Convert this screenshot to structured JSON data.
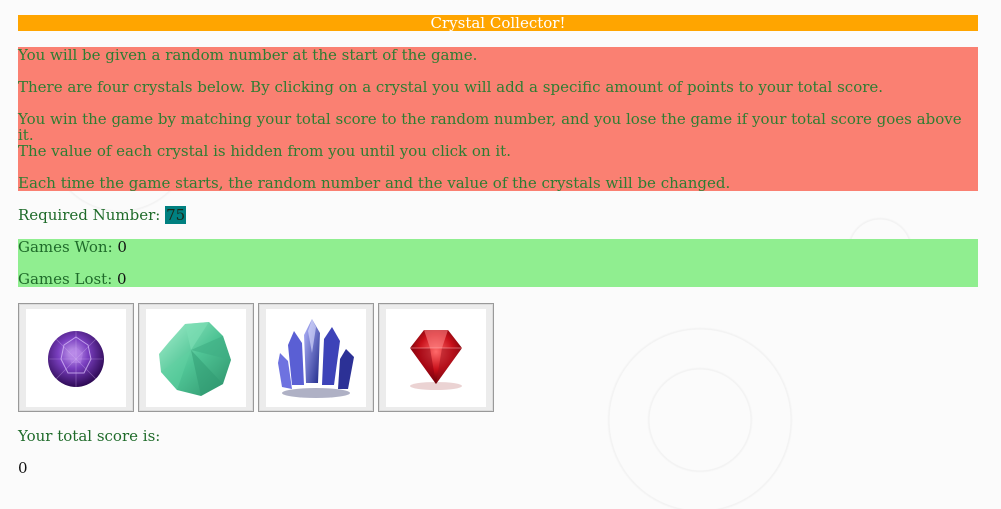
{
  "title": "Crystal Collector!",
  "instructions": [
    "You will be given a random number at the start of the game.",
    "There are four crystals below. By clicking on a crystal you will add a specific amount of points to your total score.",
    "You win the game by matching your total score to the random number, and you lose the game if your total score goes above it.",
    "The value of each crystal is hidden from you until you click on it.",
    "Each time the game starts, the random number and the value of the crystals will be changed."
  ],
  "required": {
    "label": "Required Number: ",
    "value": "75"
  },
  "stats": {
    "won_label": "Games Won: ",
    "won_value": "0",
    "lost_label": "Games Lost: ",
    "lost_value": "0"
  },
  "crystals": [
    {
      "icon": "purple-amethyst-crystal-icon"
    },
    {
      "icon": "green-crystal-icon"
    },
    {
      "icon": "blue-crystal-cluster-icon"
    },
    {
      "icon": "red-ruby-crystal-icon"
    }
  ],
  "total": {
    "label": "Your total score is:",
    "value": "0"
  },
  "colors": {
    "title_bg": "#FFA500",
    "instructions_bg": "#FA8072",
    "stats_bg": "#90EE90",
    "required_highlight": "#008080",
    "text_green": "#1f6b2a"
  }
}
